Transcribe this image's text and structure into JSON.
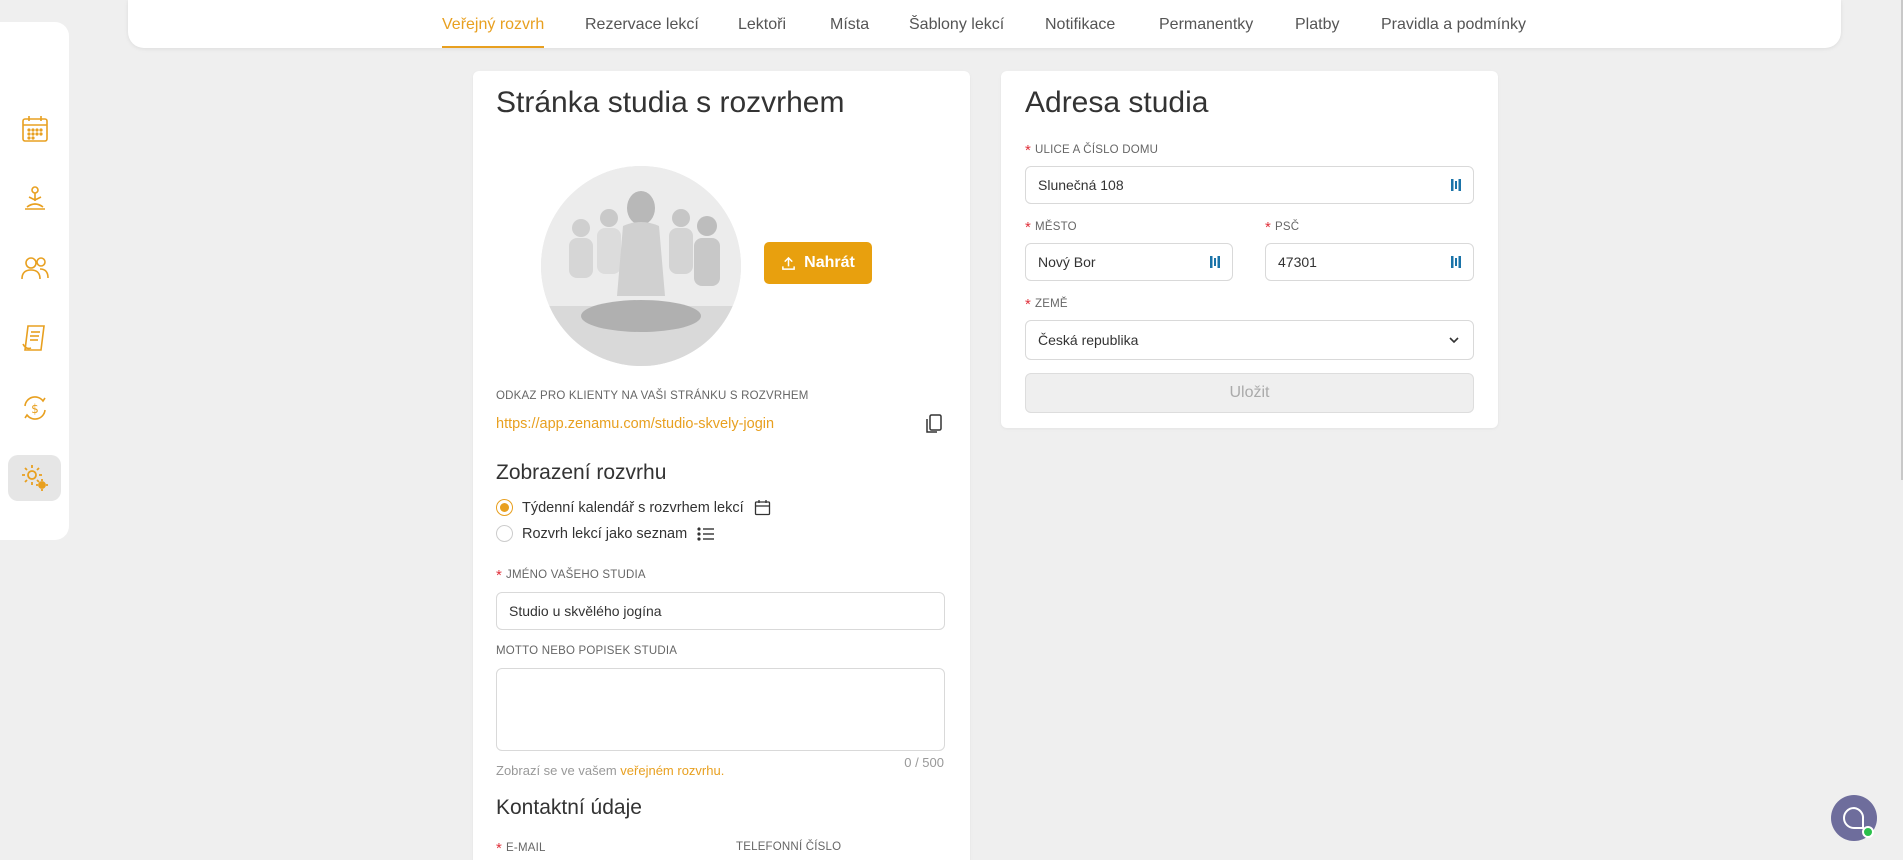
{
  "nav": {
    "tabs": [
      {
        "label": "Veřejný rozvrh",
        "active": true
      },
      {
        "label": "Rezervace lekcí"
      },
      {
        "label": "Lektoři"
      },
      {
        "label": "Místa"
      },
      {
        "label": "Šablony lekcí"
      },
      {
        "label": "Notifikace"
      },
      {
        "label": "Permanentky"
      },
      {
        "label": "Platby"
      },
      {
        "label": "Pravidla a podmínky"
      }
    ]
  },
  "sidebar": {
    "items": [
      {
        "icon": "calendar-icon"
      },
      {
        "icon": "yoga-person-icon"
      },
      {
        "icon": "users-icon"
      },
      {
        "icon": "receipt-icon"
      },
      {
        "icon": "payment-cycle-icon"
      },
      {
        "icon": "settings-gear-icon",
        "active": true
      }
    ]
  },
  "studio_page": {
    "title": "Stránka studia s rozvrhem",
    "upload_label": "Nahrát",
    "link_label": "ODKAZ PRO KLIENTY NA VAŠI STRÁNKU S ROZVRHEM",
    "link_url": "https://app.zenamu.com/studio-skvely-jogin",
    "display_heading": "Zobrazení rozvrhu",
    "display_options": [
      {
        "label": "Týdenní kalendář s rozvrhem lekcí",
        "checked": true
      },
      {
        "label": "Rozvrh lekcí jako seznam",
        "checked": false
      }
    ],
    "name_label": "JMÉNO VAŠEHO STUDIA",
    "name_value": "Studio u skvělého jogína",
    "motto_label": "MOTTO NEBO POPISEK STUDIA",
    "motto_value": "",
    "motto_counter": "0 / 500",
    "hint_prefix": "Zobrazí se ve vašem ",
    "hint_link": "veřejném rozvrhu.",
    "contact_heading": "Kontaktní údaje",
    "email_label": "E-MAIL",
    "phone_label": "TELEFONNÍ ČÍSLO"
  },
  "address": {
    "title": "Adresa studia",
    "street_label": "ULICE A ČÍSLO DOMU",
    "street_value": "Slunečná 108",
    "city_label": "MĚSTO",
    "city_value": "Nový Bor",
    "zip_label": "PSČ",
    "zip_value": "47301",
    "country_label": "ZEMĚ",
    "country_value": "Česká republika",
    "save_label": "Uložit"
  },
  "colors": {
    "accent": "#e8a020",
    "required": "#e0323c",
    "background": "#efefef"
  }
}
